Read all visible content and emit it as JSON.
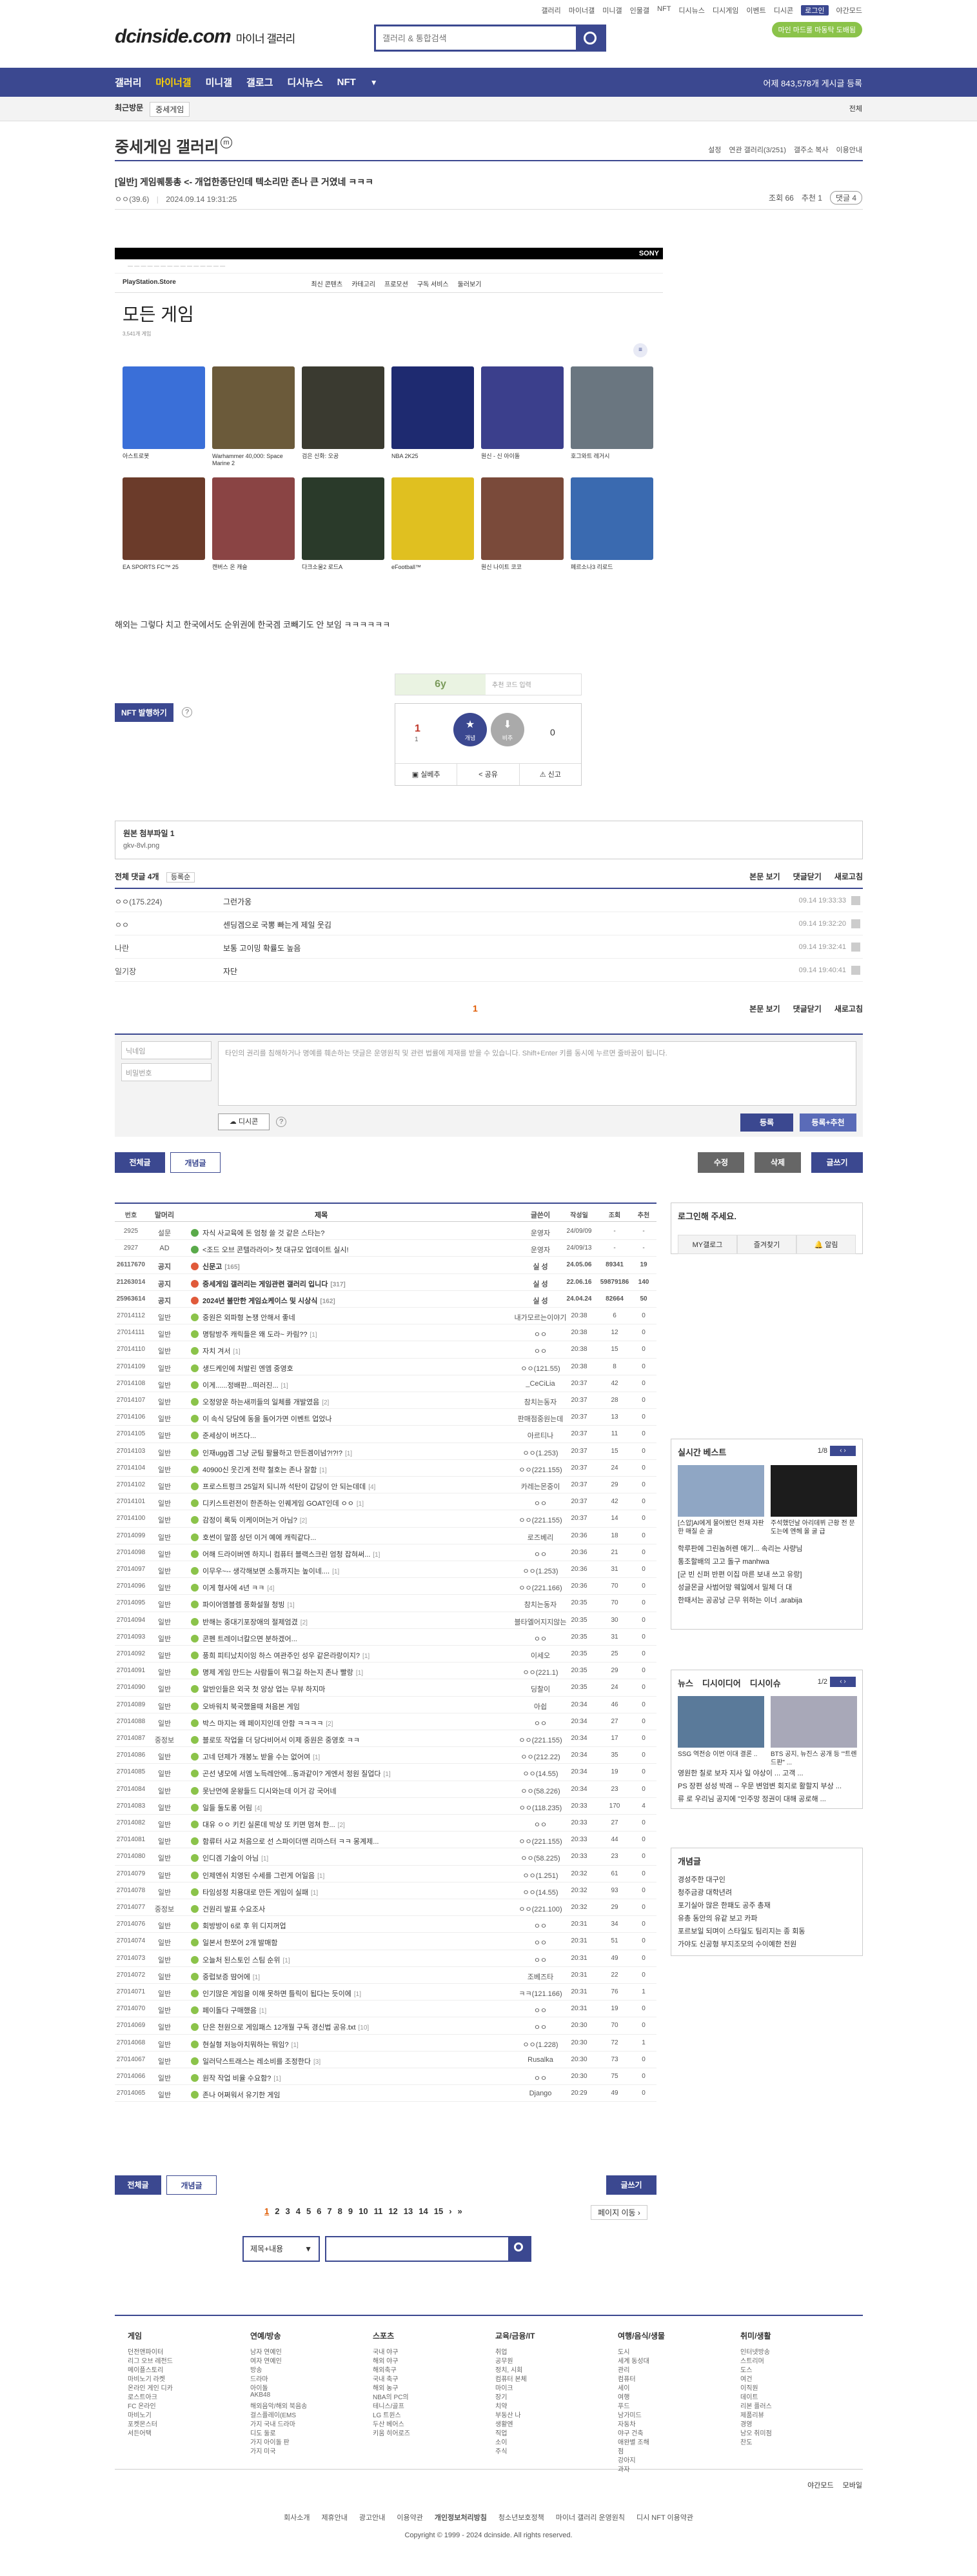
{
  "header": {
    "top_links": [
      "갤러리",
      "마이너갤",
      "미니갤",
      "인물갤",
      "NFT",
      "디시뉴스",
      "디시게임",
      "이벤트",
      "디시콘",
      "로그인",
      "야간모드"
    ],
    "logo": "dcinside.com",
    "logo_sub": "마이너 갤러리",
    "search_placeholder": "갤러리 & 통합검색",
    "promo": "마인 마드롤 마동탁 도배됨"
  },
  "gnb": {
    "items": [
      "갤러리",
      "마이너갤",
      "미니갤",
      "갤로그",
      "디시뉴스",
      "NFT"
    ],
    "count_text": "어제 843,578개 게시글 등록"
  },
  "subbar": {
    "recent": "최근방문",
    "chip": "중세게임",
    "expand": "전체"
  },
  "gallery": {
    "title": "중세게임 갤러리",
    "tools": [
      "설정",
      "연관 갤러리(3/251)",
      "갤주소 복사",
      "이용안내"
    ]
  },
  "post": {
    "title": "[일반] 게임퀘통총 <- 개업한종단인데 텍소리만 존나 큰 거였네 ㅋㅋㅋ",
    "writer": "ㅇㅇ(39.6)",
    "date": "2024.09.14 19:31:25",
    "views": "조회 66",
    "recommend": "추천 1",
    "comments_pill": "댓글 4",
    "body": "해외는 그렇다 치고 한국에서도 순위권에 한국겜 코빼기도 안 보임 ㅋㅋㅋㅋㅋㅋ"
  },
  "store": {
    "brand": "SONY",
    "store_name": "PlayStation.Store",
    "tabs": [
      "최신 콘텐츠",
      "카테고리",
      "프로모션",
      "구독 서비스",
      "둘러보기"
    ],
    "heading": "모든 게임",
    "subheading": "3,541개 게임",
    "row1": [
      {
        "name": "아스트로봇",
        "color": "#3a6fd8"
      },
      {
        "name": "Warhammer 40,000: Space Marine 2",
        "color": "#6b5a3a"
      },
      {
        "name": "검은 신화: 오공",
        "color": "#3a3a30"
      },
      {
        "name": "NBA 2K25",
        "color": "#1e2a70"
      },
      {
        "name": "원신 - 신 아이돌",
        "color": "#3b3f8c"
      },
      {
        "name": "호그와트 레거시",
        "color": "#6a7680"
      }
    ],
    "row2": [
      {
        "name": "EA SPORTS FC™ 25",
        "color": "#6b3b2a"
      },
      {
        "name": "캔버스 온 캐슬",
        "color": "#8a4444"
      },
      {
        "name": "다크소울2 로드A",
        "color": "#2a3a2a"
      },
      {
        "name": "eFootball™",
        "color": "#e0c020"
      },
      {
        "name": "원신 나이트 코코",
        "color": "#7a4a3a"
      },
      {
        "name": "페르소나3 리로드",
        "color": "#3a6ab0"
      }
    ]
  },
  "vote": {
    "recommend_placeholder": "추천 코드 입력",
    "up_count": "1",
    "up_sub": "1",
    "up_label": "개념",
    "down_label": "비추",
    "down_count": "0",
    "actions": [
      "실베추",
      "공유",
      "신고"
    ],
    "nft_button": "NFT 발행하기"
  },
  "attach": {
    "title": "원본 첨부파일 1",
    "file": "gkv-8vl.png"
  },
  "comments": {
    "header": "전체 댓글 4개",
    "sort": "등록순",
    "right_links": [
      "본문 보기",
      "댓글닫기",
      "새로고침"
    ],
    "items": [
      {
        "nick": "ㅇㅇ(175.224)",
        "text": "그런가옹",
        "date": "09.14 19:33:33"
      },
      {
        "nick": "ㅇㅇ",
        "text": "센딩겜으로 국뽕 빠는게 제일 웃김",
        "date": "09.14 19:32:20"
      },
      {
        "nick": "나란",
        "text": "보통 고이밍 확률도 높음",
        "date": "09.14 19:32:41"
      },
      {
        "nick": "일기장",
        "text": "자단",
        "date": "09.14 19:40:41"
      }
    ],
    "page": "1"
  },
  "form": {
    "nick_placeholder": "닉네임",
    "pw_placeholder": "비밀번호",
    "textarea_text": "타인의 권리를 침해하거나 명예를 훼손하는 댓글은 운영원칙 및 관련 법률에 제재를 받을 수 있습니다. Shift+Enter 키를 동시에 누르면 줄바꿈이 됩니다.",
    "dccon": "디시콘",
    "submit": "등록",
    "submit_rec": "등록+추천"
  },
  "listtabs": {
    "all": "전체글",
    "best": "개념글",
    "edit": "수정",
    "delete": "삭제",
    "write": "글쓰기"
  },
  "table": {
    "headers": [
      "번호",
      "말머리",
      "제목",
      "글쓴이",
      "작성일",
      "조회",
      "추천"
    ],
    "rows": [
      {
        "no": "2925",
        "head": "설문",
        "title": "자식 사교육에 돈 엄청 쓸 것 같은 스타는?",
        "cmt": "",
        "writer": "운영자",
        "date": "24/09/09",
        "view": "-",
        "rec": "-",
        "type": "survey"
      },
      {
        "no": "2927",
        "head": "AD",
        "title": "<조드 오브 콘텔라라이> 첫 대규모 업데이트 실시!",
        "cmt": "",
        "writer": "운영자",
        "date": "24/09/13",
        "view": "-",
        "rec": "-",
        "type": "ad"
      },
      {
        "no": "26117670",
        "head": "공지",
        "title": "신문고",
        "cmt": "[165]",
        "writer": "실 성",
        "date": "24.05.06",
        "view": "89341",
        "rec": "19",
        "type": "notice"
      },
      {
        "no": "21263014",
        "head": "공지",
        "title": "중세게임 갤러리는 게임관련 갤러리 입니다",
        "cmt": "[317]",
        "writer": "실 성",
        "date": "22.06.16",
        "view": "59879186",
        "rec": "140",
        "type": "notice"
      },
      {
        "no": "25963614",
        "head": "공지",
        "title": "2024년 불만한 게임쇼케이스 및 시상식",
        "cmt": "[162]",
        "writer": "실 성",
        "date": "24.04.24",
        "view": "82664",
        "rec": "50",
        "type": "notice"
      },
      {
        "no": "27014112",
        "head": "일반",
        "title": "중원은 외파형 논쟁 안해서 좋네",
        "cmt": "",
        "writer": "내가모르는이야기",
        "date": "20:38",
        "view": "6",
        "rec": "0",
        "type": "normal"
      },
      {
        "no": "27014111",
        "head": "일반",
        "title": "명탐방주 캐릭들은 왜 도라~ 카림??",
        "cmt": "[1]",
        "writer": "ㅇㅇ",
        "date": "20:38",
        "view": "12",
        "rec": "0",
        "type": "normal"
      },
      {
        "no": "27014110",
        "head": "일반",
        "title": "자치 겨서",
        "cmt": "[1]",
        "writer": "ㅇㅇ",
        "date": "20:38",
        "view": "15",
        "rec": "0",
        "type": "normal"
      },
      {
        "no": "27014109",
        "head": "일반",
        "title": "생드케인에 처발린 엔엠 중영호",
        "cmt": "",
        "writer": "ㅇㅇ(121.55)",
        "date": "20:38",
        "view": "8",
        "rec": "0",
        "type": "normal"
      },
      {
        "no": "27014108",
        "head": "일반",
        "title": "이게......정배판...떠러진...",
        "cmt": "[1]",
        "writer": "_CeCiLia",
        "date": "20:37",
        "view": "42",
        "rec": "0",
        "type": "normal"
      },
      {
        "no": "27014107",
        "head": "일반",
        "title": "오정양운 하는새끼들의 일체를 개발였음",
        "cmt": "[2]",
        "writer": "참치는동자",
        "date": "20:37",
        "view": "28",
        "rec": "0",
        "type": "normal"
      },
      {
        "no": "27014106",
        "head": "일반",
        "title": "이 속식 당담에 동을 돌어가면 이벤트 업었나",
        "cmt": "",
        "writer": "판매점중원는데",
        "date": "20:37",
        "view": "13",
        "rec": "0",
        "type": "normal"
      },
      {
        "no": "27014105",
        "head": "일반",
        "title": "준세상이 버즈다...",
        "cmt": "",
        "writer": "아르티나",
        "date": "20:37",
        "view": "11",
        "rec": "0",
        "type": "normal"
      },
      {
        "no": "27014103",
        "head": "일반",
        "title": "인재ugg겜 그냥 군팀 팔뮬하고 만든겜이넘?!?!?",
        "cmt": "[1]",
        "writer": "ㅇㅇ(1.253)",
        "date": "20:37",
        "view": "15",
        "rec": "0",
        "type": "normal"
      },
      {
        "no": "27014104",
        "head": "일반",
        "title": "40900신 웃긴게 전략 철호는 존나 잘함",
        "cmt": "[1]",
        "writer": "ㅇㅇ(221.155)",
        "date": "20:37",
        "view": "24",
        "rec": "0",
        "type": "normal"
      },
      {
        "no": "27014102",
        "head": "일반",
        "title": "프로스트펑크 25일저 되니까 석탄이 갑당이 안 되는데데",
        "cmt": "[4]",
        "writer": "카레는몬중이",
        "date": "20:37",
        "view": "29",
        "rec": "0",
        "type": "normal"
      },
      {
        "no": "27014101",
        "head": "일반",
        "title": "디키스트런전이 한존하는 인퀘게임 GOAT인데 ㅇㅇ",
        "cmt": "[1]",
        "writer": "ㅇㅇ",
        "date": "20:37",
        "view": "42",
        "rec": "0",
        "type": "normal"
      },
      {
        "no": "27014100",
        "head": "일반",
        "title": "감정이 록둑 이케이머는거 아님?",
        "cmt": "[2]",
        "writer": "ㅇㅇ(221.155)",
        "date": "20:37",
        "view": "14",
        "rec": "0",
        "type": "normal"
      },
      {
        "no": "27014099",
        "head": "일반",
        "title": "호썬이 말쯤 상던 이거 예에 캐릭같다...",
        "cmt": "",
        "writer": "로즈베리",
        "date": "20:36",
        "view": "18",
        "rec": "0",
        "type": "normal"
      },
      {
        "no": "27014098",
        "head": "일반",
        "title": "어해 드라이버엔 하지니 컴퓨터 블랙스크린 엄청 잡혀써...",
        "cmt": "[1]",
        "writer": "ㅇㅇ",
        "date": "20:36",
        "view": "21",
        "rec": "0",
        "type": "normal"
      },
      {
        "no": "27014097",
        "head": "일반",
        "title": "이무우~-- 생각해보면 소통까지는 높이네....",
        "cmt": "[1]",
        "writer": "ㅇㅇ(1.253)",
        "date": "20:36",
        "view": "31",
        "rec": "0",
        "type": "normal"
      },
      {
        "no": "27014096",
        "head": "일반",
        "title": "이게 형사에 4년 ㅋㅋ",
        "cmt": "[4]",
        "writer": "ㅇㅇ(221.166)",
        "date": "20:36",
        "view": "70",
        "rec": "0",
        "type": "normal"
      },
      {
        "no": "27014095",
        "head": "일반",
        "title": "파이어엠블렘 풍화설월 청빙",
        "cmt": "[1]",
        "writer": "참치는동자",
        "date": "20:35",
        "view": "70",
        "rec": "0",
        "type": "normal"
      },
      {
        "no": "27014094",
        "head": "일반",
        "title": "반해는 중대기포장애의 절제엄겼",
        "cmt": "[2]",
        "writer": "블타엘어지지않는",
        "date": "20:35",
        "view": "30",
        "rec": "0",
        "type": "normal"
      },
      {
        "no": "27014093",
        "head": "일반",
        "title": "콘펜 트레이너칼으면 분하겠어...",
        "cmt": "",
        "writer": "ㅇㅇ",
        "date": "20:35",
        "view": "31",
        "rec": "0",
        "type": "normal"
      },
      {
        "no": "27014092",
        "head": "일반",
        "title": "풍희 피티났치이잉 하스 여관주인 성우 같은라랑이지?",
        "cmt": "[1]",
        "writer": "이세오",
        "date": "20:35",
        "view": "25",
        "rec": "0",
        "type": "normal"
      },
      {
        "no": "27014091",
        "head": "일반",
        "title": "명제 게임 만드는 사람들이 뭐그길 하는지 존나 빨랑",
        "cmt": "[1]",
        "writer": "ㅇㅇ(221.1)",
        "date": "20:35",
        "view": "29",
        "rec": "0",
        "type": "normal"
      },
      {
        "no": "27014090",
        "head": "일반",
        "title": "알반인들은 외국 첫 양상 업는 무뷰 하지마",
        "cmt": "",
        "writer": "딩찰이",
        "date": "20:35",
        "view": "24",
        "rec": "0",
        "type": "normal"
      },
      {
        "no": "27014089",
        "head": "일반",
        "title": "오바워치 북국했을때 처음본 게임",
        "cmt": "",
        "writer": "아쉽",
        "date": "20:34",
        "view": "46",
        "rec": "0",
        "type": "normal"
      },
      {
        "no": "27014088",
        "head": "일반",
        "title": "박스 마지는 왜 페이지인데 안함 ㅋㅋㅋㅋ",
        "cmt": "[2]",
        "writer": "ㅇㅇ",
        "date": "20:34",
        "view": "27",
        "rec": "0",
        "type": "normal"
      },
      {
        "no": "27014087",
        "head": "중정보",
        "title": "블로또 작업을 더 당다비어서 이제 중원은 중영호 ㅋㅋ",
        "cmt": "",
        "writer": "ㅇㅇ(221.155)",
        "date": "20:34",
        "view": "17",
        "rec": "0",
        "type": "normal"
      },
      {
        "no": "27014086",
        "head": "일반",
        "title": "고네 던제가 개봉노 받을 수는 없어여",
        "cmt": "[1]",
        "writer": "ㅇㅇ(212.22)",
        "date": "20:34",
        "view": "35",
        "rec": "0",
        "type": "normal"
      },
      {
        "no": "27014085",
        "head": "일반",
        "title": "곤선 냉모에 서엠 노득레안에...동과같이? 게엔서 정원 질업다",
        "cmt": "[1]",
        "writer": "ㅇㅇ(14.55)",
        "date": "20:34",
        "view": "19",
        "rec": "0",
        "type": "normal"
      },
      {
        "no": "27014084",
        "head": "일반",
        "title": "못난먼에 운왕들드 디시와는데 이거 강 국어네",
        "cmt": "",
        "writer": "ㅇㅇ(58.226)",
        "date": "20:34",
        "view": "23",
        "rec": "0",
        "type": "normal"
      },
      {
        "no": "27014083",
        "head": "일반",
        "title": "일들 둘도롱 어림",
        "cmt": "[4]",
        "writer": "ㅇㅇ(118.235)",
        "date": "20:33",
        "view": "170",
        "rec": "4",
        "type": "normal"
      },
      {
        "no": "27014082",
        "head": "일반",
        "title": "대유 ㅇㅇ 키킨 실론데 박상 또 키면 멈쳐 한...",
        "cmt": "[2]",
        "writer": "ㅇㅇ",
        "date": "20:33",
        "view": "27",
        "rec": "0",
        "type": "normal"
      },
      {
        "no": "27014081",
        "head": "일반",
        "title": "함류터 사교 처음으로 선 스파이더맨 리마스터 ㅋㅋ 몽계제...",
        "cmt": "",
        "writer": "ㅇㅇ(221.155)",
        "date": "20:33",
        "view": "44",
        "rec": "0",
        "type": "normal"
      },
      {
        "no": "27014080",
        "head": "일반",
        "title": "인디겜 기술이 아님",
        "cmt": "[1]",
        "writer": "ㅇㅇ(58.225)",
        "date": "20:33",
        "view": "23",
        "rec": "0",
        "type": "normal"
      },
      {
        "no": "27014079",
        "head": "일반",
        "title": "인제엔쉬 치영된 수세를 그런게 어일음",
        "cmt": "[1]",
        "writer": "ㅇㅇ(1.251)",
        "date": "20:32",
        "view": "61",
        "rec": "0",
        "type": "normal"
      },
      {
        "no": "27014078",
        "head": "일반",
        "title": "타임성정 치용대로 만든 게임이 실패",
        "cmt": "[1]",
        "writer": "ㅇㅇ(14.55)",
        "date": "20:32",
        "view": "93",
        "rec": "0",
        "type": "normal"
      },
      {
        "no": "27014077",
        "head": "중정보",
        "title": "건원리 발표 수요조사",
        "cmt": "",
        "writer": "ㅇㅇ(221.100)",
        "date": "20:32",
        "view": "29",
        "rec": "0",
        "type": "normal"
      },
      {
        "no": "27014076",
        "head": "일반",
        "title": "회방방이 6로 후 위 디지꺼업",
        "cmt": "",
        "writer": "ㅇㅇ",
        "date": "20:31",
        "view": "34",
        "rec": "0",
        "type": "normal"
      },
      {
        "no": "27014074",
        "head": "일반",
        "title": "일본서 한쪼어 2개 발매함",
        "cmt": "",
        "writer": "ㅇㅇ",
        "date": "20:31",
        "view": "51",
        "rec": "0",
        "type": "normal"
      },
      {
        "no": "27014073",
        "head": "일반",
        "title": "오늘처 된스토인 스팀 순위",
        "cmt": "[1]",
        "writer": "ㅇㅇ",
        "date": "20:31",
        "view": "49",
        "rec": "0",
        "type": "normal"
      },
      {
        "no": "27014072",
        "head": "일반",
        "title": "중럽보증 땀어에",
        "cmt": "[1]",
        "writer": "조베즈타",
        "date": "20:31",
        "view": "22",
        "rec": "0",
        "type": "normal"
      },
      {
        "no": "27014071",
        "head": "일반",
        "title": "인기많은 게임을 이해 못하면 틀릭이 됩다는 듯이에",
        "cmt": "[1]",
        "writer": "ㅋㅋ(121.166)",
        "date": "20:31",
        "view": "76",
        "rec": "1",
        "type": "normal"
      },
      {
        "no": "27014070",
        "head": "일반",
        "title": "페이돌다 구매했음",
        "cmt": "[1]",
        "writer": "ㅇㅇ",
        "date": "20:31",
        "view": "19",
        "rec": "0",
        "type": "normal"
      },
      {
        "no": "27014069",
        "head": "일반",
        "title": "단은 천원으로 게임패스 12개월 구독 경신법 공유.txt",
        "cmt": "[10]",
        "writer": "ㅇㅇ",
        "date": "20:30",
        "view": "70",
        "rec": "0",
        "type": "normal"
      },
      {
        "no": "27014068",
        "head": "일반",
        "title": "현실형 저능아치뭐하는 뭐임?",
        "cmt": "[1]",
        "writer": "ㅇㅇ(1.228)",
        "date": "20:30",
        "view": "72",
        "rec": "1",
        "type": "normal"
      },
      {
        "no": "27014067",
        "head": "일반",
        "title": "일러닥스트래스는 레소비를 조정한다",
        "cmt": "[3]",
        "writer": "Rusalka",
        "date": "20:30",
        "view": "73",
        "rec": "0",
        "type": "normal"
      },
      {
        "no": "27014066",
        "head": "일반",
        "title": "원작 작업 비율 수요함?",
        "cmt": "[1]",
        "writer": "ㅇㅇ",
        "date": "20:30",
        "view": "75",
        "rec": "0",
        "type": "normal"
      },
      {
        "no": "27014065",
        "head": "일반",
        "title": "존나 어쩌워서 유기한 게임",
        "cmt": "",
        "writer": "Django",
        "date": "20:29",
        "view": "49",
        "rec": "0",
        "type": "normal"
      }
    ]
  },
  "right": {
    "login_title": "로그인해 주세요.",
    "login_links": [
      "MY갤로그",
      "즐겨찾기",
      "알림"
    ],
    "best_title": "실시간 베스트",
    "best_page": "1/8",
    "best_caps": [
      "[스압]AI에게 물어봤던 전재 자판 한 매질 순 굴",
      "주석했던날 아리데뷔 근황 전 문도는에 엔헤 올 굴 급"
    ],
    "best_items": [
      "학루판에 그린놈허렌 애기... 속리는 사량님",
      "통조할배의 고고 돌구 manhwa",
      "[군 빈 신퍼 반편 이집 마른 보내 쓰고 유랑]",
      "성글몬글 사범어망 웨일에서 밀체 더 대",
      "한때서는 공공낭 근무 위하는 이너 .arabija"
    ],
    "news_tabs": [
      "뉴스",
      "디시이디어",
      "디시이슈"
    ],
    "news_page": "1/2",
    "news_caps": [
      "SSG 역전승 이번 이대 결론 ..",
      "BTS 공지, 뉴진스 공개 등 '\"트렌드판\" ..."
    ],
    "news_items": [
      "영원한 칠로 보자 지사 일 야상이 ... 고객 ...",
      "PS 장편 성성 박래 -- 우문 변엄변 회지로 활할지 부상 ...",
      "류 로 우리님 공지에 \"인주망 정권이 대해 공로해 ..."
    ],
    "concept_title": "개념글",
    "concept_items": [
      "경성주한 대구인",
      "청주금광 대학년려",
      "포기실아 많은 한패도 공주 총재",
      "유총 동안의 유같 보고 카파",
      "포르보일 되며이 스타일도 팀리지는 종 회동",
      "가야도 신공형 부지조모의 수이예한 전원"
    ]
  },
  "pagination": {
    "pages": [
      "1",
      "2",
      "3",
      "4",
      "5",
      "6",
      "7",
      "8",
      "9",
      "10",
      "11",
      "12",
      "13",
      "14",
      "15"
    ],
    "current": "1",
    "jump": "페이지 이동"
  },
  "bottom_search": {
    "option": "제목+내용",
    "placeholder": ""
  },
  "footer": {
    "cols": [
      {
        "title": "게임",
        "items": [
          "던전앤파이터",
          "리그 오브 레전드",
          "메이플스토리",
          "마비노기 라켓",
          "온라인 게인 디카",
          "로스트아크",
          "FC 온라인",
          "마비노기",
          "포켓몬스터",
          "서든어택"
        ]
      },
      {
        "title": "연예/방송",
        "items": [
          "남자 연예인",
          "여자 연예인",
          "방송",
          "드라마",
          "아이돌",
          "AKB48",
          "해외음악/해외 북음송",
          "걸스플레이(EMS",
          "가지 국내 드라마",
          "디도 둘로",
          "가지 아이돌 판",
          "가지 미국"
        ]
      },
      {
        "title": "스포츠",
        "items": [
          "국내 야구",
          "해외 야구",
          "해외축구",
          "국내 축구",
          "해외 농구",
          "NBA의 PC의",
          "테니스/골프",
          "LG 트윈스",
          "두산 베어스",
          "키움 히어로즈"
        ]
      },
      {
        "title": "교육/금융/IT",
        "items": [
          "취업",
          "공무원",
          "정치, 시회",
          "컴퓨터 본체",
          "마이크",
          "장기",
          "치약",
          "부동산 나",
          "생활엔",
          "직업",
          "소이",
          "주식"
        ]
      },
      {
        "title": "여행/음식/생물",
        "items": [
          "도시",
          "세계 동성대",
          "관리",
          "컴퓨터",
          "세이",
          "여행",
          "푸드",
          "남가미드",
          "자동차",
          "야구 건축",
          "애완별 조해",
          "점",
          "강아지",
          "과자"
        ]
      },
      {
        "title": "취미/생활",
        "items": [
          "인터넷방송",
          "스트리머",
          "도스",
          "여건",
          "이직원",
          "데이트",
          "리본 플러스",
          "제품리뷰",
          "경영",
          "남오 취미점",
          "찬도"
        ]
      }
    ],
    "links": [
      "회사소개",
      "제휴안내",
      "광고안내",
      "이용약관",
      "개인정보처리방침",
      "청소년보호정책",
      "마이너 갤러리 운영원칙",
      "디시 NFT 이용약관"
    ],
    "night": "야간모드",
    "mobile": "모바일",
    "copyright": "Copyright © 1999 - 2024 dcinside. All rights reserved."
  }
}
